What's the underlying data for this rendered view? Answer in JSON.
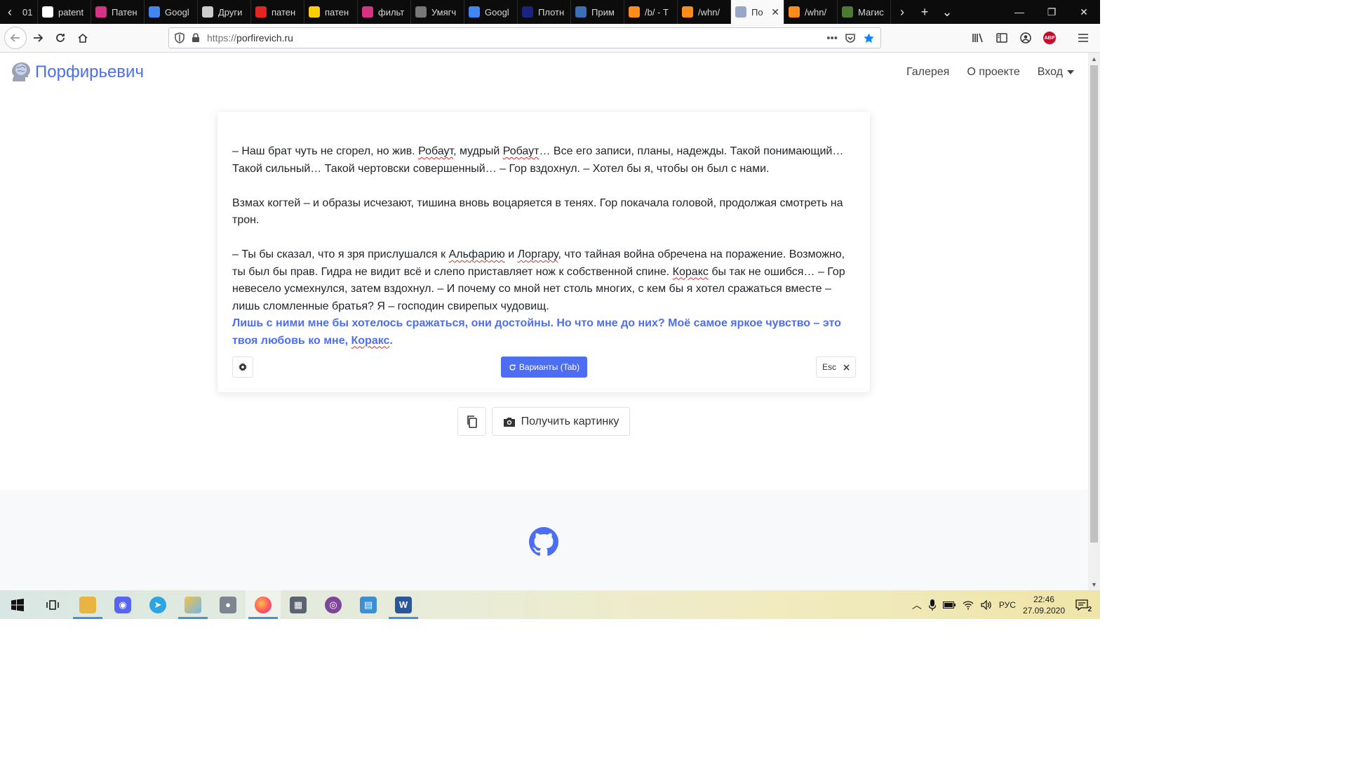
{
  "browser": {
    "tabs": [
      {
        "title": "01",
        "icon": "first-tab-icon",
        "color": "#444444"
      },
      {
        "title": "patent",
        "icon": "google-icon",
        "color": "#ffffff"
      },
      {
        "title": "Патен",
        "icon": "grid-site-icon",
        "color": "#d63384"
      },
      {
        "title": "Googl",
        "icon": "google-translate-icon",
        "color": "#4285f4"
      },
      {
        "title": "Други",
        "icon": "site-icon",
        "color": "#cccccc"
      },
      {
        "title": "патен",
        "icon": "yandex-icon",
        "color": "#e52620"
      },
      {
        "title": "патен",
        "icon": "yandex-images-icon",
        "color": "#ffcc00"
      },
      {
        "title": "фильт",
        "icon": "grid-site-icon",
        "color": "#d63384"
      },
      {
        "title": "Умягч",
        "icon": "site-icon",
        "color": "#777777"
      },
      {
        "title": "Googl",
        "icon": "google-translate-icon",
        "color": "#4285f4"
      },
      {
        "title": "Плотн",
        "icon": "aj-icon",
        "color": "#1a237e"
      },
      {
        "title": "Прим",
        "icon": "doc-icon",
        "color": "#3b6fb6"
      },
      {
        "title": "/b/ - Т",
        "icon": "bolt-icon",
        "color": "#ff8c1a"
      },
      {
        "title": "/whn/",
        "icon": "bolt-icon",
        "color": "#ff8c1a"
      },
      {
        "title": "По",
        "icon": "porfirevich-icon",
        "color": "#9aa6c8",
        "active": true
      },
      {
        "title": "/whn/",
        "icon": "bolt-icon",
        "color": "#ff8c1a"
      },
      {
        "title": "Магис",
        "icon": "game-icon",
        "color": "#4c7a2f"
      }
    ],
    "url_protocol": "https://",
    "url_host": "porfirevich.ru"
  },
  "site": {
    "brand": "Порфирьевич",
    "nav": {
      "gallery": "Галерея",
      "about": "О проекте",
      "login": "Вход"
    }
  },
  "editor": {
    "p1": {
      "a": "– Наш брат чуть не сгорел, но жив. ",
      "b": "Робаут",
      "c": ", мудрый ",
      "d": "Робаут",
      "e": "… Все его записи, планы, надежды. Такой понимающий… Такой сильный… Такой чертовски совершенный… – Гор вздохнул. – Хотел бы я, чтобы он был с нами."
    },
    "p2": "Взмах когтей – и образы исчезают, тишина вновь воцаряется в тенях. Гор покачала головой, продолжая смотреть на трон.",
    "p3": {
      "a": "– Ты бы сказал, что я зря прислушался к ",
      "b": "Альфарию",
      "c": " и ",
      "d": "Лоргару",
      "e": ", что тайная война обречена на поражение. Возможно, ты был бы прав. Гидра не видит всё и слепо приставляет нож к собственной спине. ",
      "f": "Коракс",
      "g": " бы так не ошибся… – Гор невесело усмехнулся, затем вздохнул. – И почему со мной нет столь многих, с кем бы я хотел сражаться вместе – лишь сломленные братья? Я – господин свирепых чудовищ."
    },
    "generated": {
      "a": " Лишь с ними мне бы хотелось сражаться, они достойны. Но что мне до них? Моё самое яркое чувство – это твоя любовь ко мне, ",
      "b": "Коракс",
      "c": "."
    }
  },
  "controls": {
    "variants_label": "Варианты (Tab)",
    "esc_label": "Esc",
    "get_picture_label": "Получить картинку"
  },
  "taskbar": {
    "lang": "РУС",
    "time": "22:46",
    "date": "27.09.2020",
    "notifications_count": "2"
  },
  "colors": {
    "accent": "#4d6ef2",
    "spellcheck": "#d92b2b"
  }
}
